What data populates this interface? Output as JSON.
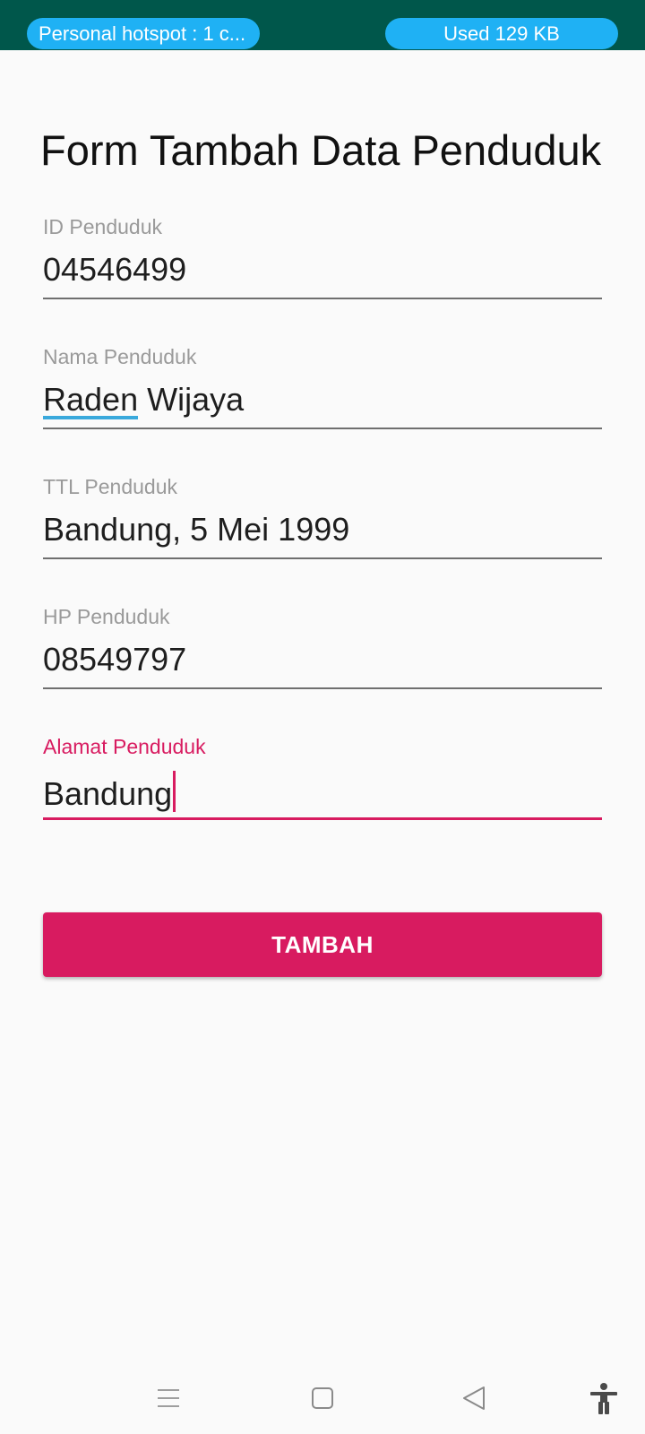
{
  "status_bar": {
    "hotspot_label": "Personal hotspot : 1 c...",
    "data_usage_label": "Used  129 KB"
  },
  "form": {
    "title": "Form Tambah Data Penduduk",
    "fields": [
      {
        "label": "ID Penduduk",
        "value": "04546499"
      },
      {
        "label": "Nama Penduduk",
        "value_underlined": "Raden",
        "value_rest": " Wijaya"
      },
      {
        "label": "TTL Penduduk",
        "value": "Bandung, 5 Mei 1999"
      },
      {
        "label": "HP Penduduk",
        "value": "08549797"
      },
      {
        "label": "Alamat Penduduk",
        "value": "Bandung",
        "focused": true
      }
    ],
    "submit_label": "TAMBAH"
  },
  "nav_bar": {
    "icons": [
      "menu-icon",
      "home-icon",
      "back-icon",
      "accessibility-icon"
    ]
  },
  "colors": {
    "status_bar_bg": "#00574b",
    "pill_bg": "#1fb1f4",
    "accent": "#d81b60",
    "background": "#fafafa"
  }
}
